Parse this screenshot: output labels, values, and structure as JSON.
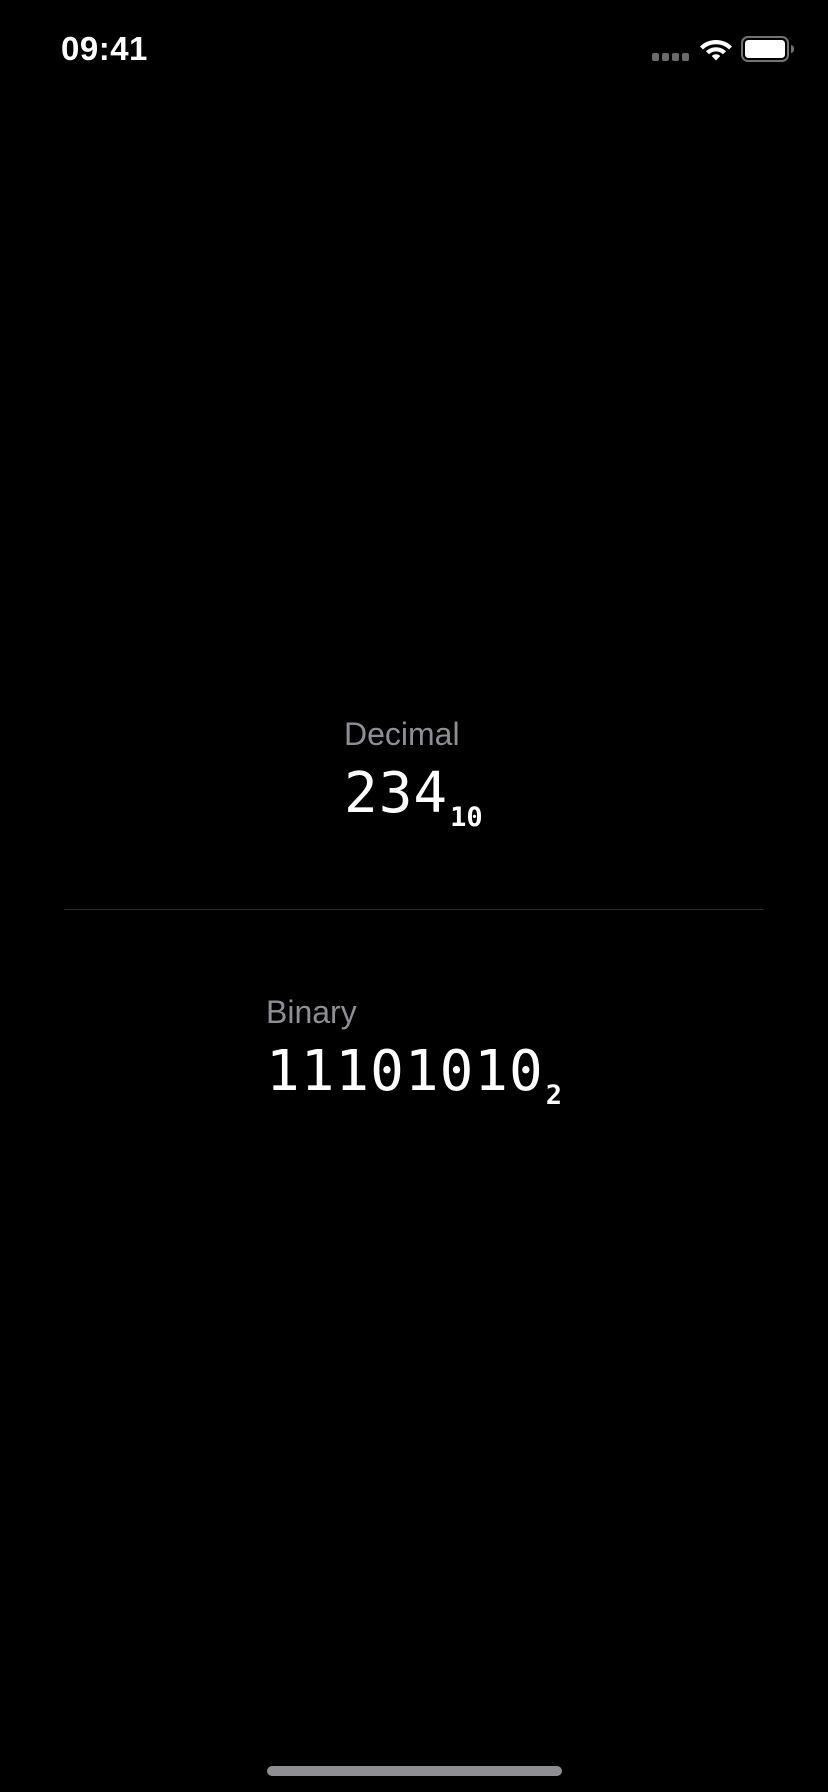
{
  "status_bar": {
    "time": "09:41",
    "signal_icon": "cellular-signal-icon",
    "wifi_icon": "wifi-icon",
    "battery_icon": "battery-icon"
  },
  "decimal": {
    "label": "Decimal",
    "value": "234",
    "base": "10"
  },
  "binary": {
    "label": "Binary",
    "value": "11101010",
    "base": "2"
  },
  "colors": {
    "background": "#000000",
    "label": "#8e8e93",
    "value": "#ffffff",
    "divider": "#2c2c2e"
  }
}
